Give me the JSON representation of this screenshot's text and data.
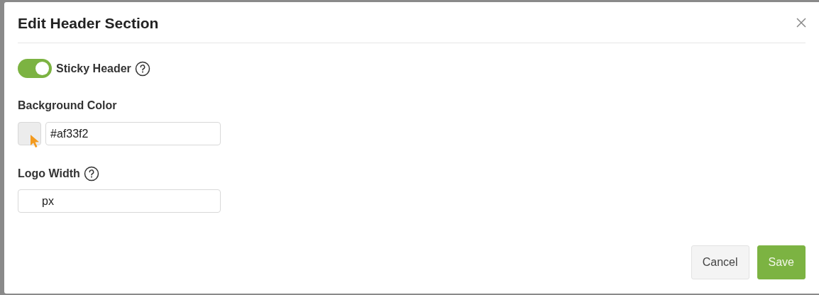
{
  "dialog": {
    "title": "Edit Header Section"
  },
  "sticky_header": {
    "label": "Sticky Header",
    "on": true
  },
  "background_color": {
    "label": "Background Color",
    "value": "#af33f2"
  },
  "logo_width": {
    "label": "Logo Width",
    "unit": "px"
  },
  "buttons": [
    {
      "label": "Cancel",
      "kind": "secondary"
    },
    {
      "label": "Save",
      "kind": "primary"
    }
  ]
}
